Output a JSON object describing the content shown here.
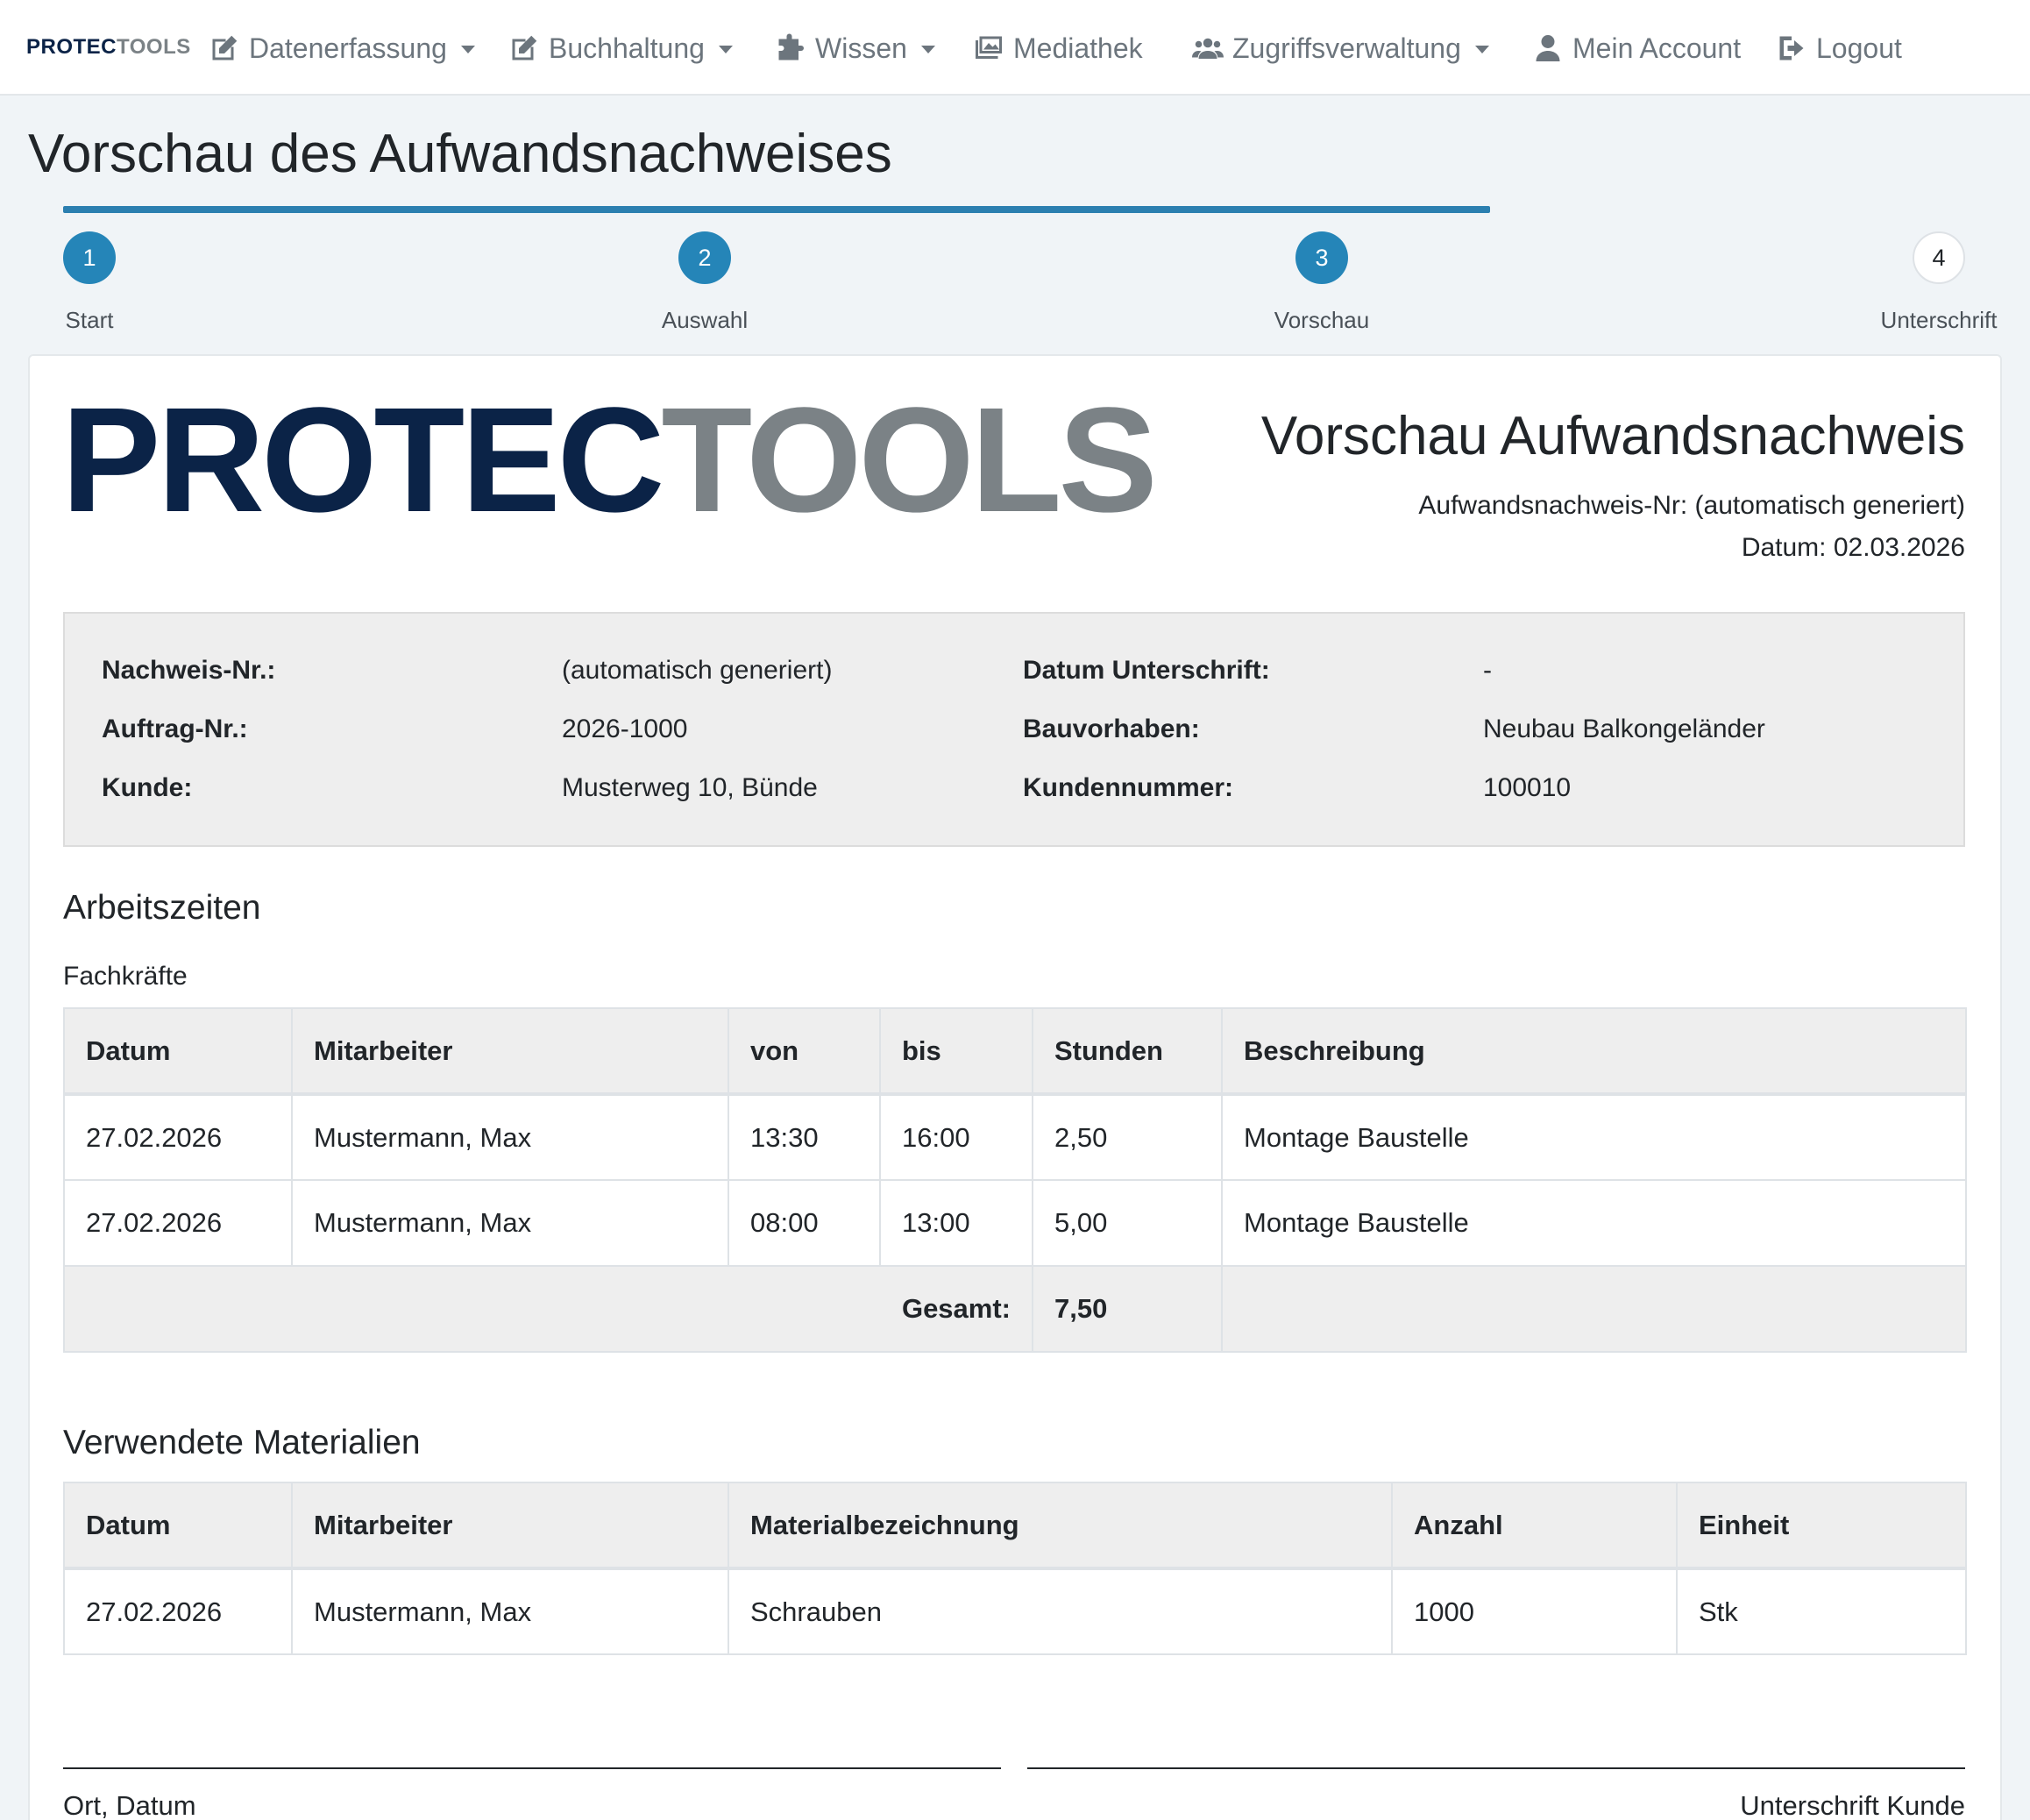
{
  "brand": {
    "part1": "PROTEC",
    "part2": "TOOLS"
  },
  "nav": [
    {
      "label": "Datenerfassung"
    },
    {
      "label": "Buchhaltung"
    },
    {
      "label": "Wissen"
    },
    {
      "label": "Mediathek"
    },
    {
      "label": "Zugriffsverwaltung"
    },
    {
      "label": "Mein Account"
    },
    {
      "label": "Logout"
    }
  ],
  "page_title": "Vorschau des Aufwandsnachweises",
  "steps": [
    {
      "number": "1",
      "label": "Start",
      "state": "done"
    },
    {
      "number": "2",
      "label": "Auswahl",
      "state": "done"
    },
    {
      "number": "3",
      "label": "Vorschau",
      "state": "done"
    },
    {
      "number": "4",
      "label": "Unterschrift",
      "state": "todo"
    }
  ],
  "document": {
    "logo_part1": "PROTEC",
    "logo_part2": "TOOLS",
    "title": "Vorschau Aufwandsnachweis",
    "number_line": "Aufwandsnachweis-Nr: (automatisch generiert)",
    "date_line": "Datum: 02.03.2026"
  },
  "info": {
    "nachweis_label": "Nachweis-Nr.:",
    "nachweis_value": "(automatisch generiert)",
    "auftrag_label": "Auftrag-Nr.:",
    "auftrag_value": "2026-1000",
    "kunde_label": "Kunde:",
    "kunde_value": "Musterweg 10, Bünde",
    "datum_unterschrift_label": "Datum Unterschrift:",
    "datum_unterschrift_value": "-",
    "bauvorhaben_label": "Bauvorhaben:",
    "bauvorhaben_value": "Neubau Balkongeländer",
    "kundennummer_label": "Kundennummer:",
    "kundennummer_value": "100010"
  },
  "arbeitszeiten": {
    "heading": "Arbeitszeiten",
    "subheading": "Fachkräfte",
    "columns": [
      "Datum",
      "Mitarbeiter",
      "von",
      "bis",
      "Stunden",
      "Beschreibung"
    ],
    "rows": [
      [
        "27.02.2026",
        "Mustermann, Max",
        "13:30",
        "16:00",
        "2,50",
        "Montage Baustelle"
      ],
      [
        "27.02.2026",
        "Mustermann, Max",
        "08:00",
        "13:00",
        "5,00",
        "Montage Baustelle"
      ]
    ],
    "total_label": "Gesamt:",
    "total_value": "7,50"
  },
  "materialien": {
    "heading": "Verwendete Materialien",
    "columns": [
      "Datum",
      "Mitarbeiter",
      "Materialbezeichnung",
      "Anzahl",
      "Einheit"
    ],
    "rows": [
      [
        "27.02.2026",
        "Mustermann, Max",
        "Schrauben",
        "1000",
        "Stk"
      ]
    ]
  },
  "signature": {
    "left_label": "Ort, Datum",
    "right_label": "Unterschrift Kunde"
  },
  "colors": {
    "primary": "#2585b8",
    "brand_dark": "#0b2347",
    "brand_gray": "#7b8286"
  }
}
